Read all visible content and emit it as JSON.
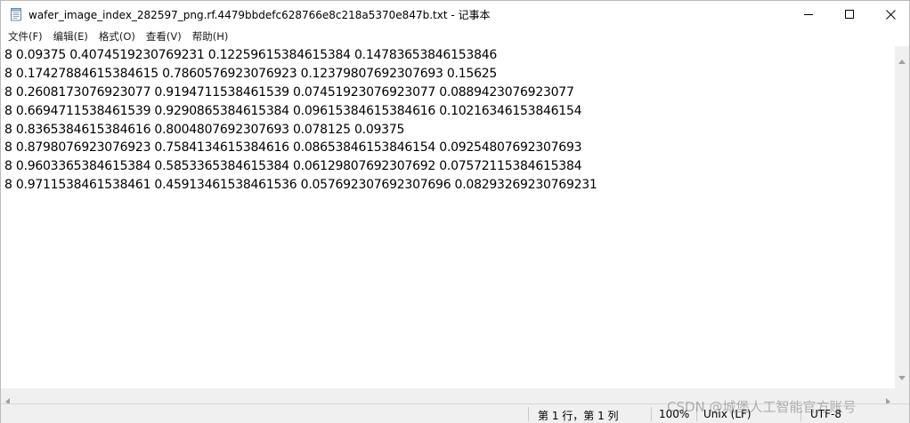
{
  "window": {
    "title": "wafer_image_index_282597_png.rf.4479bbdefc628766e8c218a5370e847b.txt - 记事本"
  },
  "menu": [
    {
      "label": "文件(F)"
    },
    {
      "label": "编辑(E)"
    },
    {
      "label": "格式(O)"
    },
    {
      "label": "查看(V)"
    },
    {
      "label": "帮助(H)"
    }
  ],
  "lines": [
    "8 0.09375 0.4074519230769231 0.12259615384615384 0.14783653846153846",
    "8 0.17427884615384615 0.7860576923076923 0.12379807692307693 0.15625",
    "8 0.2608173076923077 0.9194711538461539 0.07451923076923077 0.0889423076923077",
    "8 0.6694711538461539 0.9290865384615384 0.09615384615384616 0.10216346153846154",
    "8 0.8365384615384616 0.8004807692307693 0.078125 0.09375",
    "8 0.8798076923076923 0.7584134615384616 0.08653846153846154 0.09254807692307693",
    "8 0.9603365384615384 0.5853365384615384 0.06129807692307692 0.07572115384615384",
    "8 0.9711538461538461 0.45913461538461536 0.057692307692307696 0.08293269230769231"
  ],
  "status": {
    "position": "第 1 行，第 1 列",
    "zoom": "100%",
    "line_ending": "Unix (LF)",
    "encoding": "UTF-8"
  },
  "watermark": "CSDN @城堡人工智能官方账号",
  "icons": {
    "app": "notepad-icon",
    "minimize": "minimize-icon",
    "maximize": "maximize-icon",
    "close": "close-icon"
  }
}
